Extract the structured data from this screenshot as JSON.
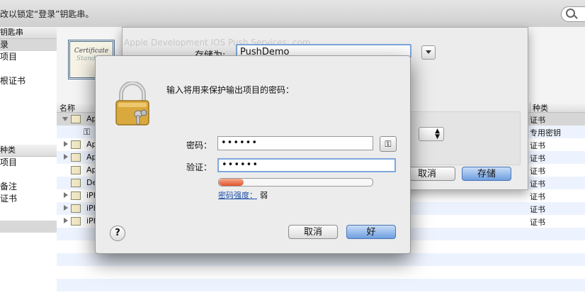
{
  "toolbar": {
    "hint": "改以锁定“登录”钥匙串。"
  },
  "search": {
    "icon": "search-icon"
  },
  "sidebar": {
    "keychains_header": "钥匙串",
    "keychain_items": [
      "录",
      "项目",
      "",
      "根证书"
    ],
    "category_header": "种类",
    "category_items": [
      "项目",
      "",
      "备注",
      "证书"
    ]
  },
  "certificate": {
    "line1": "Certificate",
    "line2": "Standard"
  },
  "list": {
    "col_name": "名称",
    "col_kind": "种类",
    "rows": [
      {
        "name": "Ap",
        "kind": "证书"
      },
      {
        "name": "",
        "kind": "专用密钥"
      },
      {
        "name": "Ap",
        "kind": "证书"
      },
      {
        "name": "Ap",
        "kind": "证书"
      },
      {
        "name": "Ap",
        "kind": "证书"
      },
      {
        "name": "De",
        "kind": "证书"
      },
      {
        "name": "iPh",
        "kind": "证书"
      },
      {
        "name": "iPh",
        "kind": "证书"
      },
      {
        "name": "iPh",
        "kind": "证书"
      }
    ]
  },
  "save_sheet": {
    "ghost_title": "Apple Development IOS Push Services: com...",
    "save_as_label": "存储为:",
    "filename": "PushDemo",
    "cancel_label": "取消",
    "save_label": "存储"
  },
  "password_dialog": {
    "title": "输入将用来保护输出项目的密码：",
    "password_label": "密码：",
    "password_value": "••••••",
    "verify_label": "验证：",
    "verify_value": "••••••",
    "strength_label": "密码强度：",
    "strength_value": "弱",
    "strength_level": 0.16,
    "help_label": "?",
    "cancel_label": "取消",
    "ok_label": "好",
    "key_button": "⚿"
  },
  "colors": {
    "accent": "#6f9fe0",
    "strength_weak": "#e0532d",
    "link": "#1d4ea8"
  }
}
